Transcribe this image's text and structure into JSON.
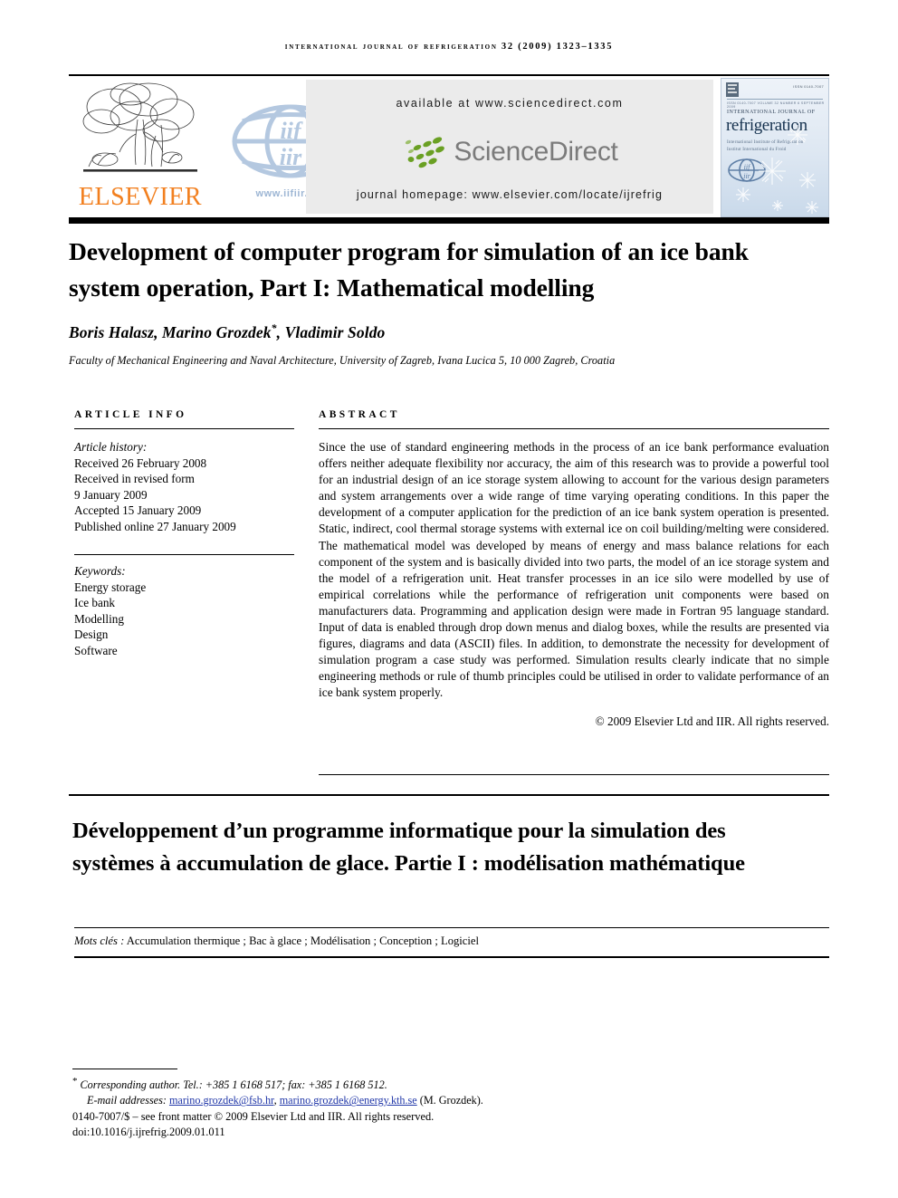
{
  "running_head": "INTERNATIONAL JOURNAL OF REFRIGERATION 32 (2009) 1323–1335",
  "masthead": {
    "elsevier_wordmark": "ELSEVIER",
    "elsevier_orange": "#f28020",
    "iir_url": "www.iifiir.org",
    "iir_blue": "#9db6d4",
    "sciencedirect": {
      "available_at": "available at www.sciencedirect.com",
      "logo_text": "ScienceDirect",
      "journal_homepage": "journal homepage: www.elsevier.com/locate/ijrefrig",
      "banner_bg": "#ebebeb",
      "leaf_green": "#6aa023",
      "wordmark_gray": "#7b7b7b"
    },
    "cover": {
      "elsevier_label": "ELSEVIER",
      "code": "ISSN 0140-7007",
      "issn_line": "ISSN 0140-7007 VOLUME 32 NUMBER 6 SEPTEMBER 2009",
      "kicker": "INTERNATIONAL JOURNAL OF",
      "title": "refrigeration",
      "subtitle_1": "International Institute of Refrigeration",
      "subtitle_2": "Institut International du Froid"
    }
  },
  "title": "Development of computer program for simulation of an ice bank system operation, Part I: Mathematical modelling",
  "authors": "Boris Halasz, Marino Grozdek",
  "authors_suffix": ", Vladimir Soldo",
  "author_star": "*",
  "affiliation": "Faculty of Mechanical Engineering and Naval Architecture, University of Zagreb, Ivana Lucica 5, 10 000 Zagreb, Croatia",
  "article_info": {
    "heading": "ARTICLE INFO",
    "history_label": "Article history:",
    "history": [
      "Received 26 February 2008",
      "Received in revised form",
      "9 January 2009",
      "Accepted 15 January 2009",
      "Published online 27 January 2009"
    ],
    "keywords_label": "Keywords:",
    "keywords": [
      "Energy storage",
      "Ice bank",
      "Modelling",
      "Design",
      "Software"
    ]
  },
  "abstract": {
    "heading": "ABSTRACT",
    "text": "Since the use of standard engineering methods in the process of an ice bank performance evaluation offers neither adequate flexibility nor accuracy, the aim of this research was to provide a powerful tool for an industrial design of an ice storage system allowing to account for the various design parameters and system arrangements over a wide range of time varying operating conditions. In this paper the development of a computer application for the prediction of an ice bank system operation is presented. Static, indirect, cool thermal storage systems with external ice on coil building/melting were considered. The mathematical model was developed by means of energy and mass balance relations for each component of the system and is basically divided into two parts, the model of an ice storage system and the model of a refrigeration unit. Heat transfer processes in an ice silo were modelled by use of empirical correlations while the performance of refrigeration unit components were based on manufacturers data. Programming and application design were made in Fortran 95 language standard. Input of data is enabled through drop down menus and dialog boxes, while the results are presented via figures, diagrams and data (ASCII) files. In addition, to demonstrate the necessity for development of simulation program a case study was performed. Simulation results clearly indicate that no simple engineering methods or rule of thumb principles could be utilised in order to validate performance of an ice bank system properly.",
    "copyright": "© 2009 Elsevier Ltd and IIR. All rights reserved."
  },
  "french": {
    "title": "Développement d’un programme informatique pour la simulation des systèmes à accumulation de glace. Partie I : modélisation mathématique",
    "keywords_label": "Mots clés :",
    "keywords_text": " Accumulation thermique ; Bac à glace ; Modélisation ; Conception ; Logiciel"
  },
  "footnote": {
    "corresponding": "Corresponding author. Tel.: +385 1 6168 517; fax: +385 1 6168 512.",
    "email_label": "E-mail addresses:",
    "email_1": "marino.grozdek@fsb.hr",
    "email_sep": ", ",
    "email_2": "marino.grozdek@energy.kth.se",
    "email_attrib": " (M. Grozdek).",
    "frontmatter": "0140-7007/$ – see front matter © 2009 Elsevier Ltd and IIR. All rights reserved.",
    "doi": "doi:10.1016/j.ijrefrig.2009.01.011",
    "link_color": "#2137a8"
  }
}
